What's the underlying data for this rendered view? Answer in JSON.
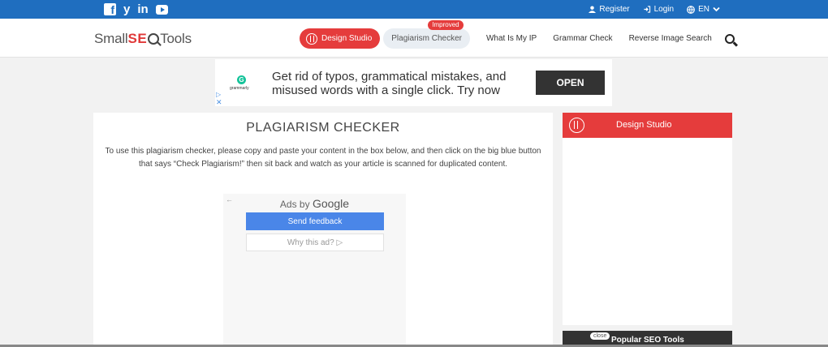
{
  "topbar": {
    "social": [
      {
        "name": "facebook",
        "glyph": "f"
      },
      {
        "name": "twitter",
        "glyph": "y"
      },
      {
        "name": "linkedin",
        "glyph": "in"
      },
      {
        "name": "youtube",
        "glyph": ""
      }
    ],
    "register": "Register",
    "login": "Login",
    "language": "EN"
  },
  "nav": {
    "logo": {
      "small": "Small",
      "seo": "SE",
      "tools": "Tools"
    },
    "design_studio": "Design Studio",
    "plagiarism_checker": "Plagiarism Checker",
    "badge": "Improved",
    "what_is_my_ip": "What Is My IP",
    "grammar_check": "Grammar Check",
    "reverse_image_search": "Reverse Image Search"
  },
  "top_ad": {
    "brand": "grammarly",
    "brand_glyph": "G",
    "text": "Get rid of typos, grammatical mistakes, and misused words with a single click. Try now",
    "button": "OPEN",
    "play": "▷",
    "close": "✕"
  },
  "main": {
    "title": "PLAGIARISM CHECKER",
    "description": "To use this plagiarism checker, please copy and paste your content in the box below, and then click on the big blue button that says “Check Plagiarism!” then sit back and watch as your article is scanned for duplicated content.",
    "google_ad": {
      "back": "←",
      "ads_by": "Ads by",
      "google": "Google",
      "send_feedback": "Send feedback",
      "why_this_ad": "Why this ad? ▷"
    }
  },
  "sidebar": {
    "header": "Design Studio",
    "popular": "Popular SEO Tools",
    "close": "close"
  },
  "colors": {
    "topbar": "#1f6ebf",
    "accent_red": "#e53c3c",
    "feedback_blue": "#4a86e8"
  }
}
